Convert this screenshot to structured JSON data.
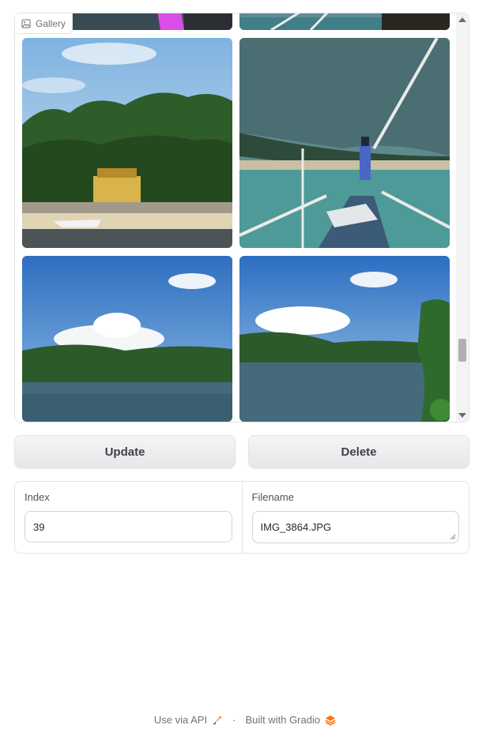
{
  "gallery": {
    "label": "Gallery",
    "images": [
      {
        "id": "img-top-left",
        "desc": "partial image, dark with magenta stripe"
      },
      {
        "id": "img-top-right",
        "desc": "partial image, boat railing"
      },
      {
        "id": "img-beach",
        "desc": "palm trees beach with house and boat"
      },
      {
        "id": "img-boat",
        "desc": "boat bow under canopy with person standing"
      },
      {
        "id": "img-lagoon-left",
        "desc": "lagoon with clouds and green islands"
      },
      {
        "id": "img-lagoon-right",
        "desc": "lagoon with clouds and green islands and foliage"
      }
    ]
  },
  "buttons": {
    "update": "Update",
    "delete": "Delete"
  },
  "form": {
    "index_label": "Index",
    "index_value": "39",
    "filename_label": "Filename",
    "filename_value": "IMG_3864.JPG"
  },
  "footer": {
    "api_label": "Use via API",
    "separator": "·",
    "built_label": "Built with Gradio"
  },
  "colors": {
    "accent": "#f97316",
    "border": "#e4e4e7",
    "button_text": "#3f3f46"
  }
}
